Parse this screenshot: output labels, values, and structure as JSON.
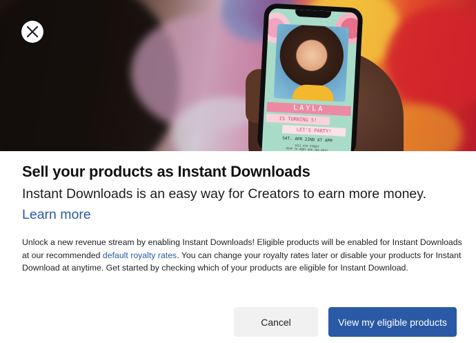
{
  "hero": {
    "invitation": {
      "name": "LAYLA",
      "turning": "IS TURNING 5!",
      "party": "LET'S PARTY!",
      "date": "SAT. APR 22ND AT 4PM",
      "address_line1": "1811 4TH STREET",
      "address_line2": "RSVP TO ANDY 456.384.8818"
    }
  },
  "dialog": {
    "close_icon": "close-x-icon",
    "title": "Sell your products as Instant Downloads",
    "subtitle": "Instant Downloads is an easy way for Creators to earn more money.",
    "learn_more": "Learn more",
    "body_before_link": "Unlock a new revenue stream by enabling Instant Downloads! Eligible products will be enabled for Instant Downloads at our recommended ",
    "body_link": "default royalty rates",
    "body_after_link": ". You can change your royalty rates later or disable your products for Instant Download at anytime. Get started by checking which of your products are eligible for Instant Download.",
    "cancel_label": "Cancel",
    "primary_label": "View my eligible products"
  },
  "colors": {
    "link": "#2c5aa0",
    "primary_button": "#2a5aa6",
    "secondary_button": "#f1f1f2"
  }
}
